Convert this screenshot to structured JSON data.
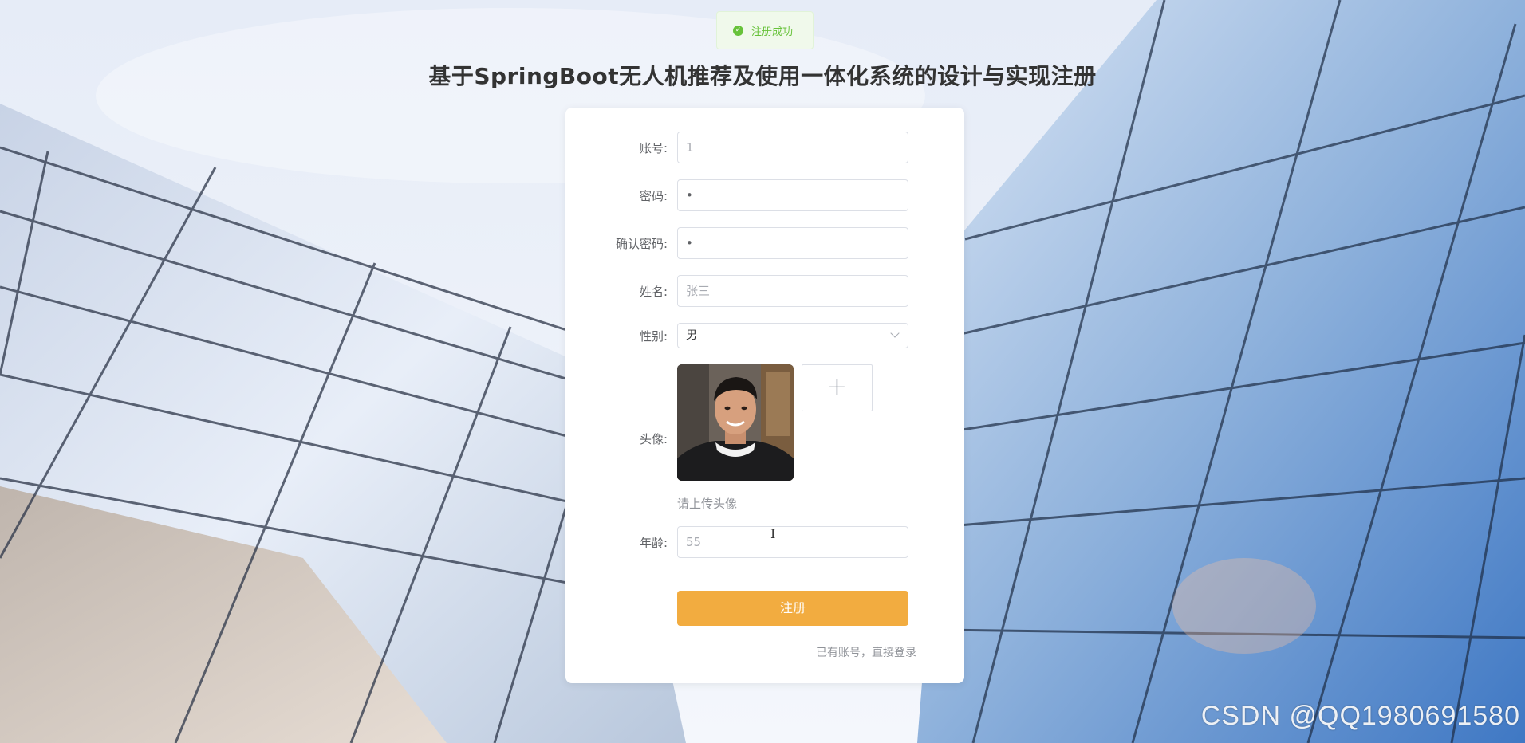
{
  "toast": {
    "text": "注册成功",
    "color": "#67c23a"
  },
  "page_title": "基于SpringBoot无人机推荐及使用一体化系统的设计与实现注册",
  "form": {
    "account": {
      "label": "账号:",
      "value": "1"
    },
    "password": {
      "label": "密码:",
      "value": "•"
    },
    "confirm_password": {
      "label": "确认密码:",
      "value": "•"
    },
    "name": {
      "label": "姓名:",
      "value": "张三"
    },
    "gender": {
      "label": "性别:",
      "value": "男"
    },
    "avatar": {
      "label": "头像:",
      "upload_symbol": "+",
      "hint": "请上传头像"
    },
    "age": {
      "label": "年龄:",
      "value": "55"
    }
  },
  "buttons": {
    "submit": "注册",
    "login_link": "已有账号，直接登录"
  },
  "watermark": "CSDN @QQ1980691580",
  "colors": {
    "primary_button": "#f2ac40",
    "success": "#67c23a"
  }
}
